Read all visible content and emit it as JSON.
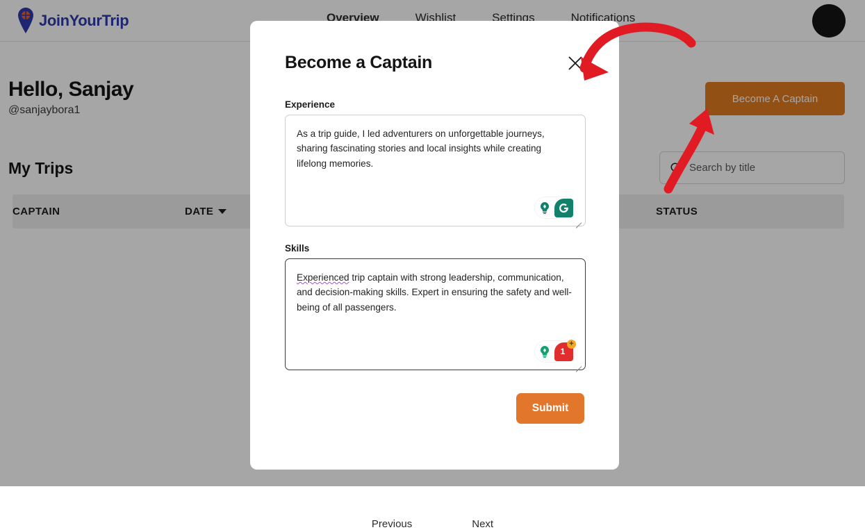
{
  "brand": {
    "name": "JoinYourTrip",
    "logo_icon": "map-pin-icon"
  },
  "nav": {
    "items": [
      {
        "label": "Overview",
        "active": true
      },
      {
        "label": "Wishlist",
        "active": false
      },
      {
        "label": "Settings",
        "active": false
      },
      {
        "label": "Notifications",
        "active": false
      }
    ]
  },
  "account": {
    "avatar_icon": "avatar-circle-icon"
  },
  "greeting": {
    "title": "Hello, Sanjay",
    "handle": "@sanjaybora1"
  },
  "actions": {
    "become_captain_label": "Become A Captain"
  },
  "trips": {
    "section_title": "My Trips",
    "search": {
      "placeholder": "Search by title",
      "value": "",
      "icon": "search-icon"
    },
    "columns": [
      {
        "label": "CAPTAIN",
        "sort_icon": ""
      },
      {
        "label": "DATE",
        "sort_icon": "chevron-down-icon"
      },
      {
        "label": "STATUS",
        "sort_icon": ""
      }
    ],
    "rows": []
  },
  "pagination": {
    "previous_label": "Previous",
    "next_label": "Next"
  },
  "modal": {
    "title": "Become a Captain",
    "close_icon": "close-icon",
    "experience": {
      "label": "Experience",
      "value": "As a trip guide, I led adventurers on unforgettable journeys, sharing fascinating stories and local insights while creating lifelong memories.",
      "assistant": {
        "bulb_icon": "lightbulb-icon",
        "logo_icon": "grammarly-logo-icon",
        "badge": "",
        "state": "clear"
      }
    },
    "skills": {
      "label": "Skills",
      "misspelled_word": "Experienced",
      "value_rest": " trip captain with strong leadership, communication, and decision-making skills. Expert in ensuring the safety and well-being of all passengers.",
      "value": "Experienced trip captain with strong leadership, communication, and decision-making skills. Expert in ensuring the safety and well-being of all passengers.",
      "assistant": {
        "bulb_icon": "lightbulb-icon",
        "logo_icon": "grammarly-logo-icon",
        "badge": "1",
        "plus": "+",
        "state": "issues"
      }
    },
    "submit_label": "Submit"
  },
  "annotations": [
    {
      "name": "arrow-to-close-button",
      "color": "#e01b24"
    },
    {
      "name": "arrow-to-become-captain-button",
      "color": "#e01b24"
    }
  ],
  "colors": {
    "brand": "#2f3bb0",
    "cta": "#e07b20",
    "submit": "#e2772b",
    "annotation": "#e01b24",
    "grammarly_green": "#15c39a",
    "grammarly_red": "#e02d2d"
  }
}
